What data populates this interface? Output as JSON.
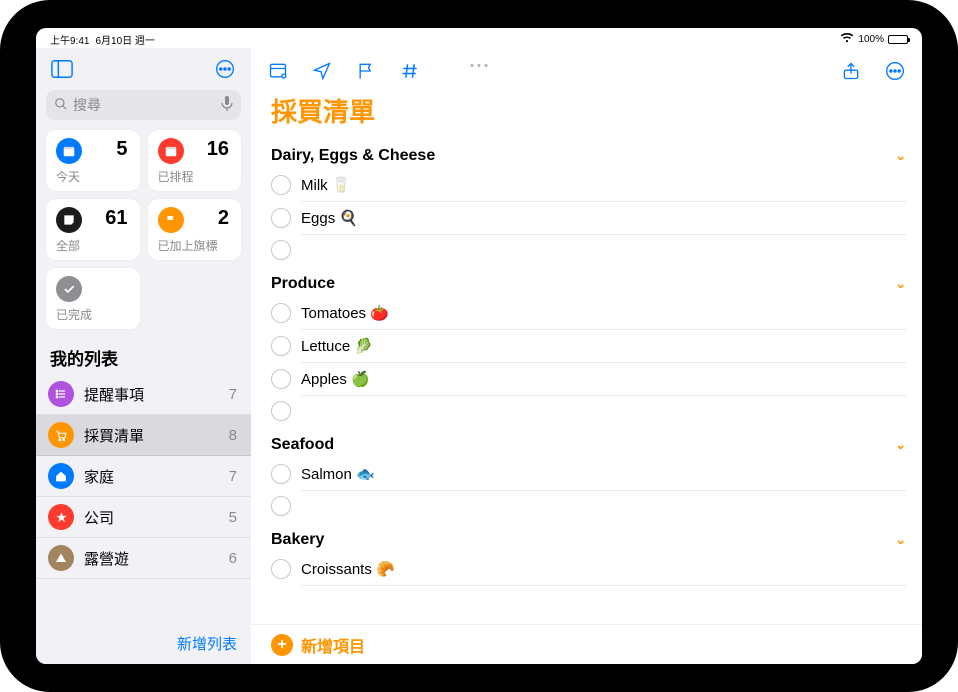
{
  "status": {
    "time": "上午9:41",
    "date": "6月10日 週一",
    "battery": "100%"
  },
  "sidebar": {
    "search_placeholder": "搜尋",
    "smart": [
      {
        "label": "今天",
        "count": 5,
        "color": "bg-blue",
        "glyph": "calendar"
      },
      {
        "label": "已排程",
        "count": 16,
        "color": "bg-red",
        "glyph": "calendar"
      },
      {
        "label": "全部",
        "count": 61,
        "color": "bg-black",
        "glyph": "inbox"
      },
      {
        "label": "已加上旗標",
        "count": 2,
        "color": "bg-orange",
        "glyph": "flag"
      },
      {
        "label": "已完成",
        "count": "",
        "color": "bg-gray",
        "glyph": "check",
        "full": true
      }
    ],
    "section_title": "我的列表",
    "lists": [
      {
        "label": "提醒事項",
        "count": 7,
        "color": "bg-purple",
        "glyph": "list"
      },
      {
        "label": "採買清單",
        "count": 8,
        "color": "bg-iorange",
        "glyph": "cart",
        "selected": true
      },
      {
        "label": "家庭",
        "count": 7,
        "color": "bg-iblue",
        "glyph": "home"
      },
      {
        "label": "公司",
        "count": 5,
        "color": "bg-ired",
        "glyph": "star"
      },
      {
        "label": "露營遊",
        "count": 6,
        "color": "bg-ibrown",
        "glyph": "tent"
      }
    ],
    "footer_add": "新增列表"
  },
  "main": {
    "title": "採買清單",
    "add_label": "新增項目",
    "sections": [
      {
        "name": "Dairy, Eggs & Cheese",
        "items": [
          "Milk 🥛",
          "Eggs 🍳"
        ],
        "empty_trailing": true
      },
      {
        "name": "Produce",
        "items": [
          "Tomatoes 🍅",
          "Lettuce 🥬",
          "Apples 🍏"
        ],
        "empty_trailing": true
      },
      {
        "name": "Seafood",
        "items": [
          "Salmon 🐟"
        ],
        "empty_trailing": true
      },
      {
        "name": "Bakery",
        "items": [
          "Croissants 🥐"
        ],
        "empty_trailing": false
      }
    ]
  }
}
